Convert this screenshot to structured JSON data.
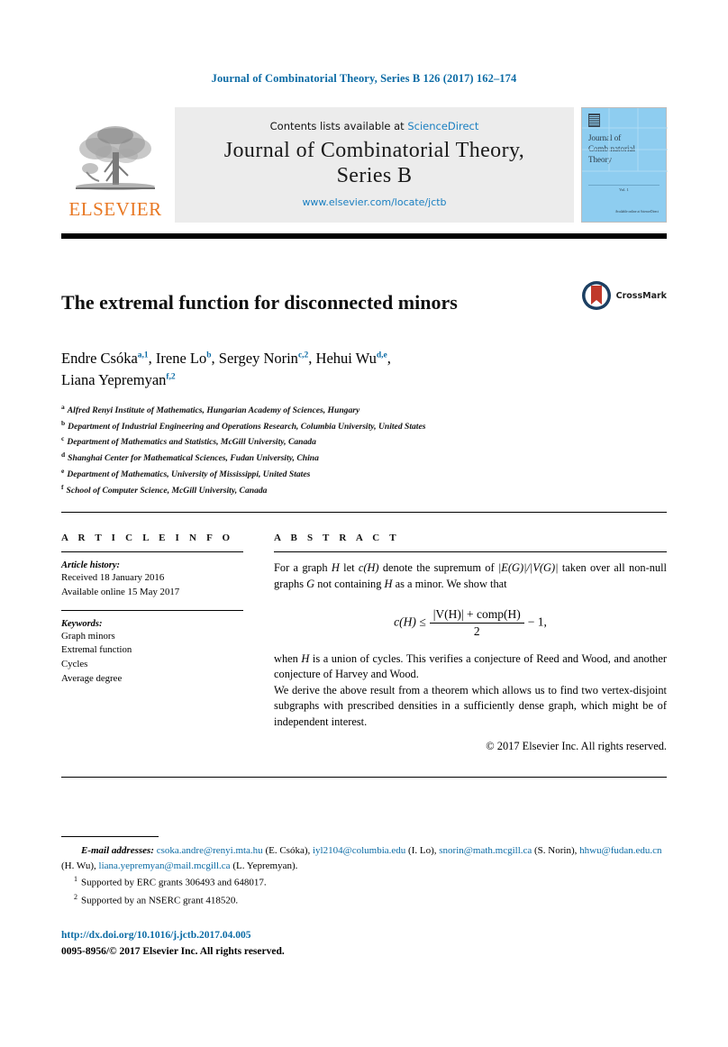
{
  "running_head": "Journal of Combinatorial Theory, Series B 126 (2017) 162–174",
  "header": {
    "publisher": "ELSEVIER",
    "contents_prefix": "Contents lists available at ",
    "contents_link": "ScienceDirect",
    "journal_title_line1": "Journal of Combinatorial Theory,",
    "journal_title_line2": "Series B",
    "journal_url": "www.elsevier.com/locate/jctb",
    "cover": {
      "title": "Journal of Combinatorial Theory",
      "volume_label": "Vol. 1",
      "footer": "Available online at\nScienceDirect"
    }
  },
  "article": {
    "title": "The extremal function for disconnected minors",
    "crossmark_label": "CrossMark",
    "authors": [
      {
        "name": "Endre Csóka",
        "sups": "a,1"
      },
      {
        "name": "Irene Lo",
        "sups": "b"
      },
      {
        "name": "Sergey Norin",
        "sups": "c,2"
      },
      {
        "name": "Hehui Wu",
        "sups": "d,e"
      },
      {
        "name": "Liana Yepremyan",
        "sups": "f,2"
      }
    ],
    "affiliations": [
      {
        "marker": "a",
        "text": "Alfred Renyi Institute of Mathematics, Hungarian Academy of Sciences, Hungary"
      },
      {
        "marker": "b",
        "text": "Department of Industrial Engineering and Operations Research, Columbia University, United States"
      },
      {
        "marker": "c",
        "text": "Department of Mathematics and Statistics, McGill University, Canada"
      },
      {
        "marker": "d",
        "text": "Shanghai Center for Mathematical Sciences, Fudan University, China"
      },
      {
        "marker": "e",
        "text": "Department of Mathematics, University of Mississippi, United States"
      },
      {
        "marker": "f",
        "text": "School of Computer Science, McGill University, Canada"
      }
    ]
  },
  "article_info": {
    "heading": "A R T I C L E    I N F O",
    "history_label": "Article history:",
    "received": "Received 18 January 2016",
    "available": "Available online 15 May 2017",
    "keywords_label": "Keywords:",
    "keywords": [
      "Graph minors",
      "Extremal function",
      "Cycles",
      "Average degree"
    ]
  },
  "abstract": {
    "heading": "A B S T R A C T",
    "para1_a": "For a graph ",
    "para1_h": "H",
    "para1_b": " let ",
    "para1_c": "c(H)",
    "para1_d": " denote the supremum of ",
    "para1_e": "|E(G)|/|V(G)|",
    "para1_f": " taken over all non-null graphs ",
    "para1_g": "G",
    "para1_h2": " not containing ",
    "para1_i": "H",
    "para1_j": " as a minor. We show that",
    "formula": {
      "lhs": "c(H) ≤",
      "numerator": "|V(H)| + comp(H)",
      "denominator": "2",
      "rhs": "− 1,"
    },
    "para2_a": "when ",
    "para2_h": "H",
    "para2_b": " is a union of cycles. This verifies a conjecture of Reed and Wood, and another conjecture of Harvey and Wood.",
    "para3": "We derive the above result from a theorem which allows us to find two vertex-disjoint subgraphs with prescribed densities in a sufficiently dense graph, which might be of independent interest.",
    "copyright": "© 2017 Elsevier Inc. All rights reserved."
  },
  "footnotes": {
    "email_label": "E-mail addresses:",
    "emails": [
      {
        "address": "csoka.andre@renyi.mta.hu",
        "who": "(E. Csóka),"
      },
      {
        "address": "iyl2104@columbia.edu",
        "who": "(I. Lo),"
      },
      {
        "address": "snorin@math.mcgill.ca",
        "who": "(S. Norin),"
      },
      {
        "address": "hhwu@fudan.edu.cn",
        "who": "(H. Wu),"
      },
      {
        "address": "liana.yepremyan@mail.mcgill.ca",
        "who": "(L. Yepremyan)."
      }
    ],
    "notes": [
      {
        "marker": "1",
        "text": "Supported by ERC grants 306493 and 648017."
      },
      {
        "marker": "2",
        "text": "Supported by an NSERC grant 418520."
      }
    ],
    "doi": "http://dx.doi.org/10.1016/j.jctb.2017.04.005",
    "issn": "0095-8956/© 2017 Elsevier Inc. All rights reserved."
  },
  "colors": {
    "link": "#0b6ba5",
    "elsevier_orange": "#e87722",
    "cover_blue": "#8ecdf0",
    "band_gray": "#ececec"
  }
}
